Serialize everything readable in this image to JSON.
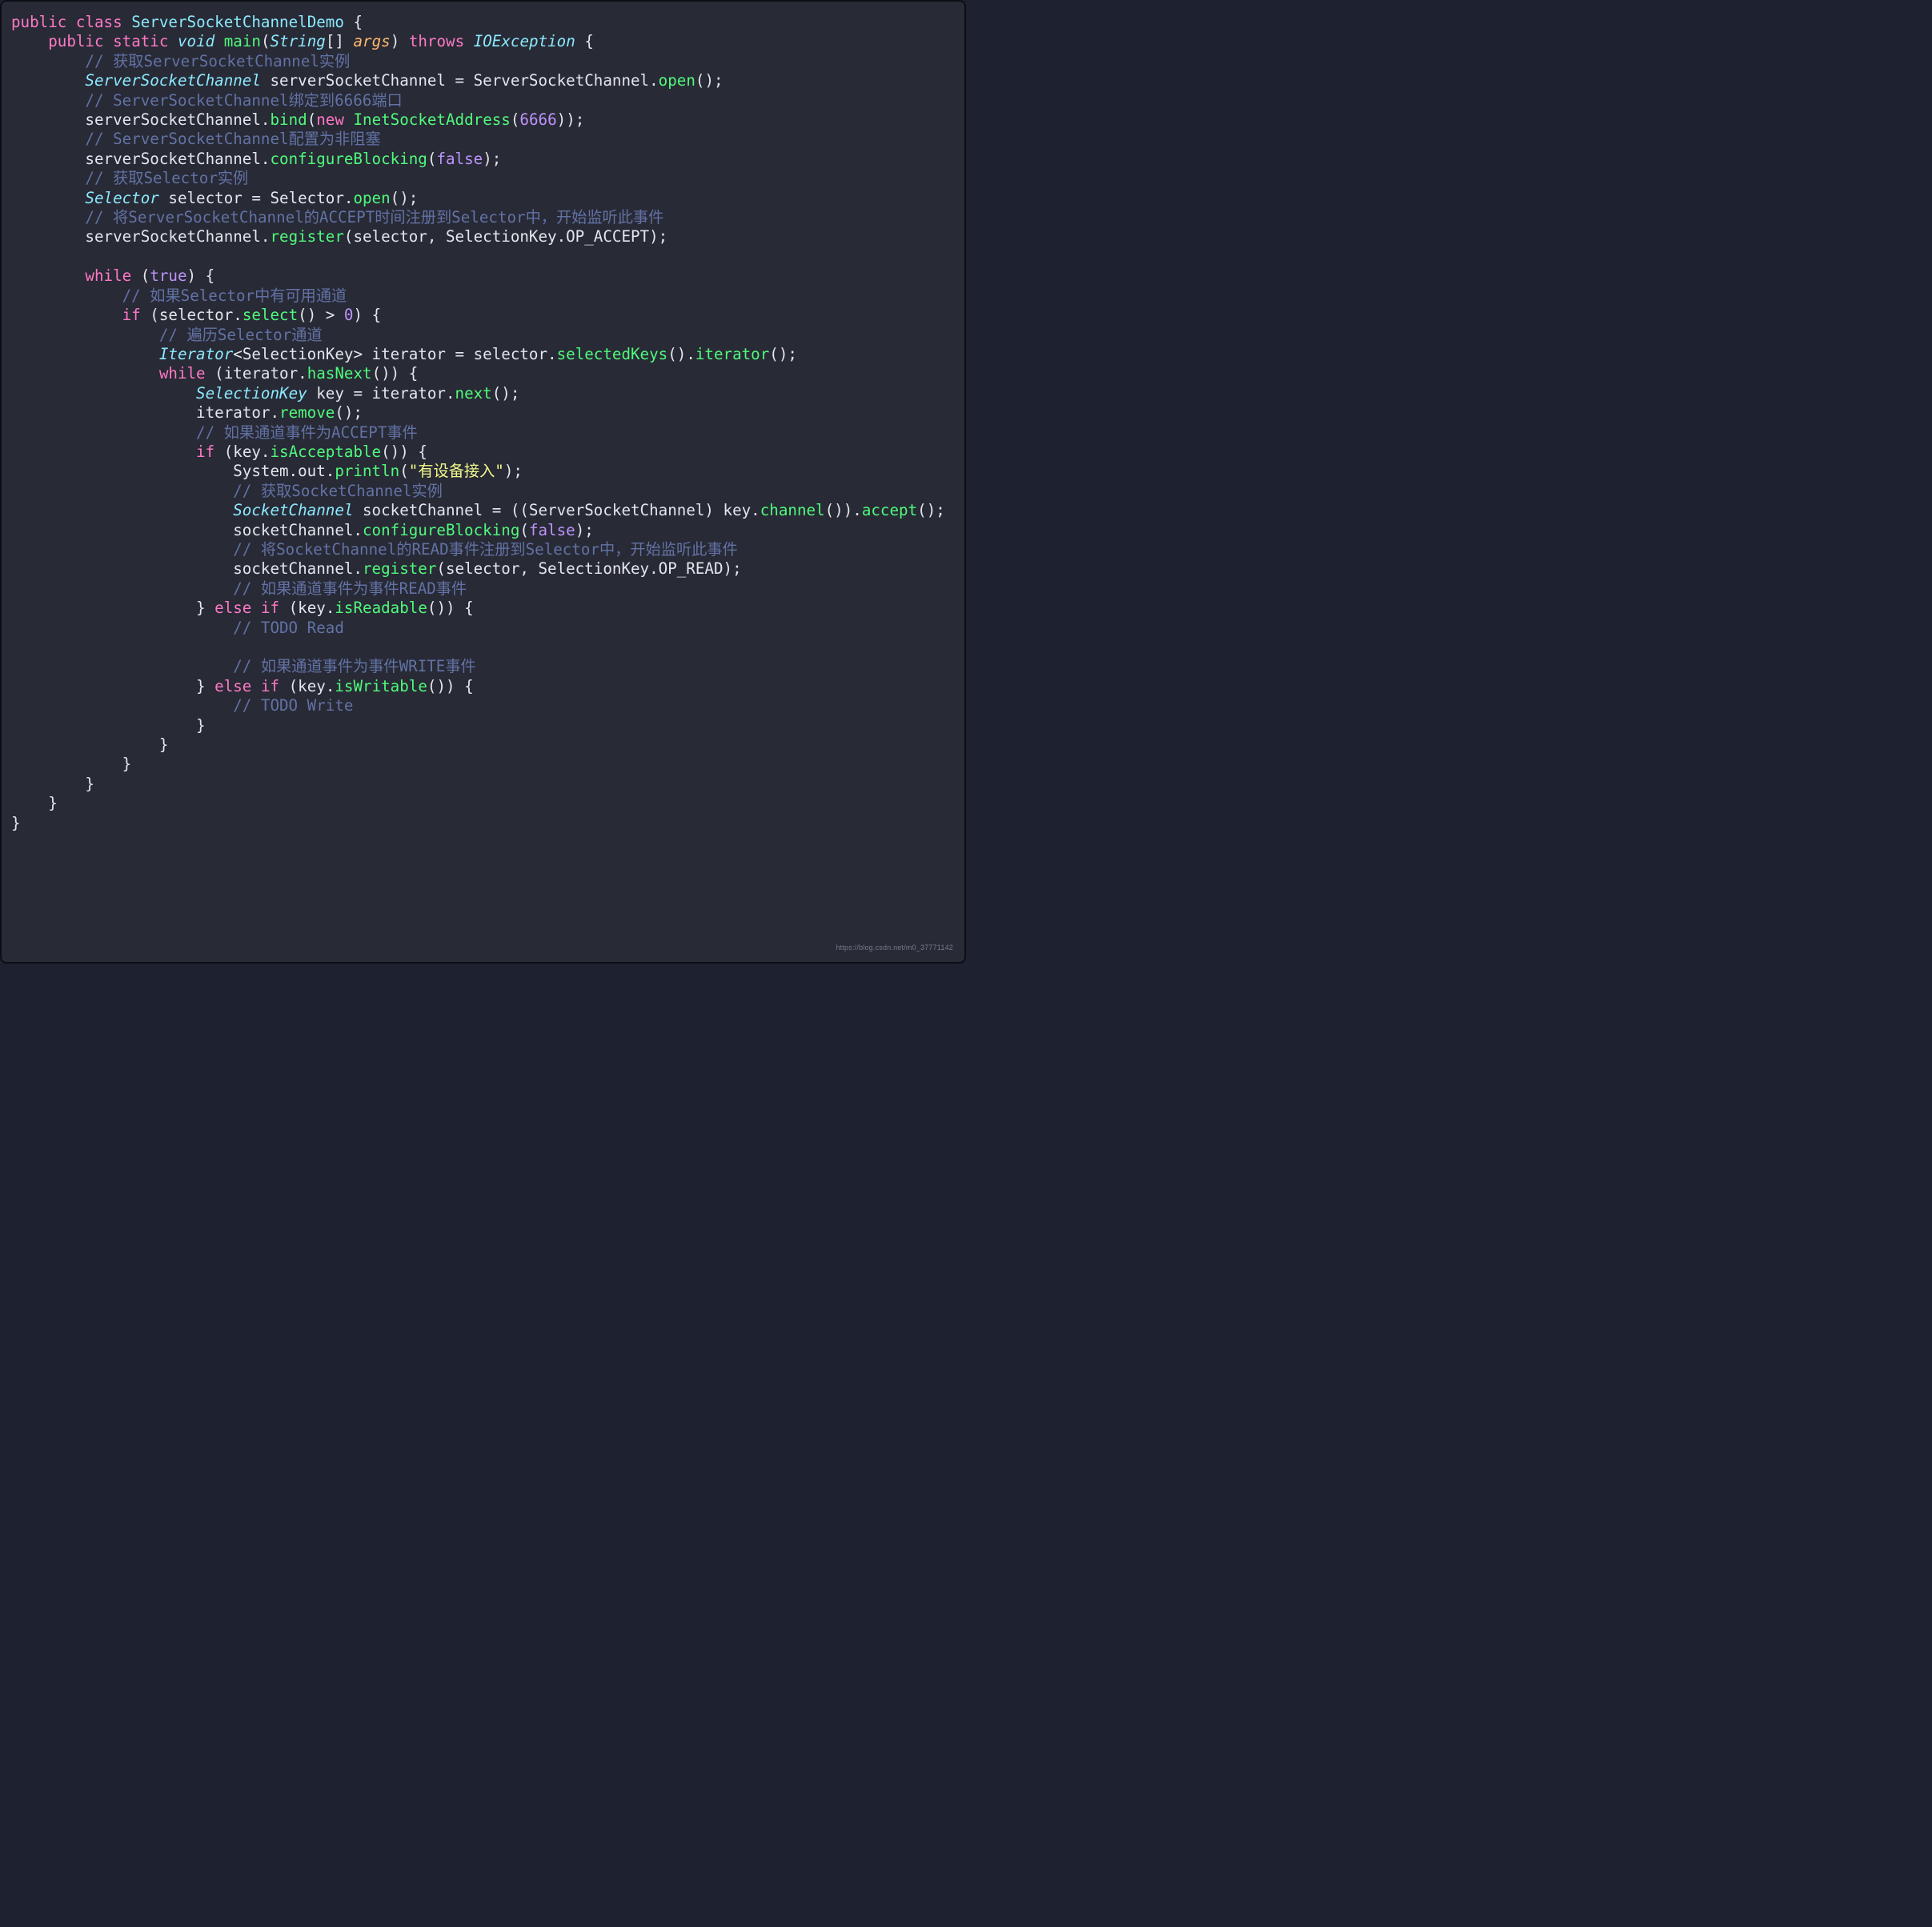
{
  "watermark": "https://blog.csdn.net/m0_37771142",
  "code": {
    "l1": {
      "a": "public",
      "b": "class",
      "c": "ServerSocketChannelDemo"
    },
    "l2": {
      "a": "public",
      "b": "static",
      "c": "void",
      "d": "main",
      "e": "String",
      "f": "args",
      "g": "throws",
      "h": "IOException"
    },
    "l3": "// 获取ServerSocketChannel实例",
    "l4": {
      "a": "ServerSocketChannel",
      "b": "serverSocketChannel = ServerSocketChannel.",
      "c": "open",
      "d": "();"
    },
    "l5": "// ServerSocketChannel绑定到6666端口",
    "l6": {
      "a": "serverSocketChannel.",
      "b": "bind",
      "c": "(",
      "d": "new",
      "e": "InetSocketAddress",
      "f": "(",
      "g": "6666",
      "h": "));"
    },
    "l7": "// ServerSocketChannel配置为非阻塞",
    "l8": {
      "a": "serverSocketChannel.",
      "b": "configureBlocking",
      "c": "(",
      "d": "false",
      "e": ");"
    },
    "l9": "// 获取Selector实例",
    "l10": {
      "a": "Selector",
      "b": "selector = Selector.",
      "c": "open",
      "d": "();"
    },
    "l11": "// 将ServerSocketChannel的ACCEPT时间注册到Selector中，开始监听此事件",
    "l12": {
      "a": "serverSocketChannel.",
      "b": "register",
      "c": "(selector, SelectionKey.OP_ACCEPT);"
    },
    "l14": {
      "a": "while",
      "b": "(",
      "c": "true",
      "d": ") {"
    },
    "l15": "// 如果Selector中有可用通道",
    "l16": {
      "a": "if",
      "b": "(selector.",
      "c": "select",
      "d": "() > ",
      "e": "0",
      "f": ") {"
    },
    "l17": "// 遍历Selector通道",
    "l18": {
      "a": "Iterator",
      "b": "<SelectionKey> iterator = selector.",
      "c": "selectedKeys",
      "d": "().",
      "e": "iterator",
      "f": "();"
    },
    "l19": {
      "a": "while",
      "b": "(iterator.",
      "c": "hasNext",
      "d": "()) {"
    },
    "l20": {
      "a": "SelectionKey",
      "b": "key = iterator.",
      "c": "next",
      "d": "();"
    },
    "l21": {
      "a": "iterator.",
      "b": "remove",
      "c": "();"
    },
    "l22": "// 如果通道事件为ACCEPT事件",
    "l23": {
      "a": "if",
      "b": "(key.",
      "c": "isAcceptable",
      "d": "()) {"
    },
    "l24": {
      "a": "System.out.",
      "b": "println",
      "c": "(",
      "d": "\"有设备接入\"",
      "e": ");"
    },
    "l25": "// 获取SocketChannel实例",
    "l26": {
      "a": "SocketChannel",
      "b": "socketChannel = ((ServerSocketChannel) key.",
      "c": "channel",
      "d": "()).",
      "e": "accept",
      "f": "();"
    },
    "l27": {
      "a": "socketChannel.",
      "b": "configureBlocking",
      "c": "(",
      "d": "false",
      "e": ");"
    },
    "l28": "// 将SocketChannel的READ事件注册到Selector中，开始监听此事件",
    "l29": {
      "a": "socketChannel.",
      "b": "register",
      "c": "(selector, SelectionKey.OP_READ);"
    },
    "l30": "// 如果通道事件为事件READ事件",
    "l31": {
      "a": "} ",
      "b": "else",
      "c": "if",
      "d": "(key.",
      "e": "isReadable",
      "f": "()) {"
    },
    "l32": "// TODO Read",
    "l34": "// 如果通道事件为事件WRITE事件",
    "l35": {
      "a": "} ",
      "b": "else",
      "c": "if",
      "d": "(key.",
      "e": "isWritable",
      "f": "()) {"
    },
    "l36": "// TODO Write",
    "l37": "}",
    "l38": "}",
    "l39": "}",
    "l40": "}",
    "l41": "}",
    "l42": "}"
  }
}
